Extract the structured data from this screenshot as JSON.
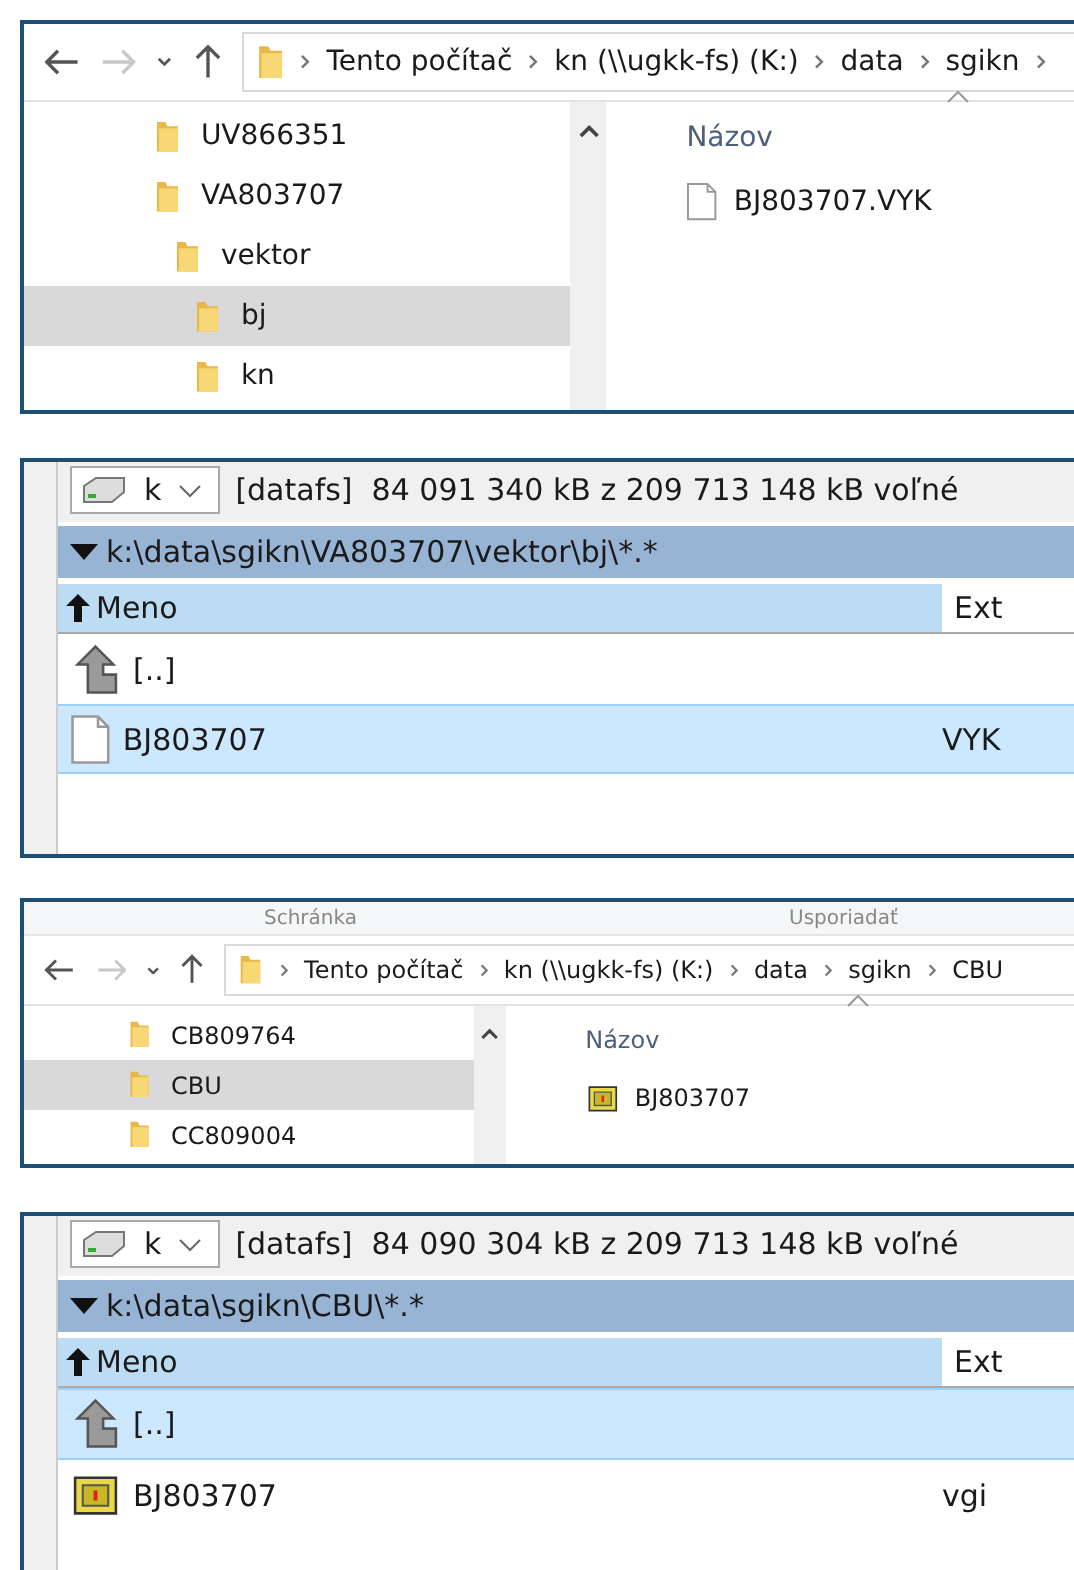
{
  "panels": [
    {
      "kind": "explorer",
      "breadcrumbs": [
        "Tento počítač",
        "kn (\\\\ugkk-fs) (K:)",
        "data",
        "sgikn"
      ],
      "more": true,
      "tree": [
        {
          "label": "UV866351",
          "selected": false
        },
        {
          "label": "VA803707",
          "selected": false,
          "children": [
            {
              "label": "vektor",
              "selected": false,
              "children": [
                {
                  "label": "bj",
                  "selected": true
                },
                {
                  "label": "kn",
                  "selected": false
                }
              ]
            }
          ]
        }
      ],
      "column": "Názov",
      "files": [
        {
          "name": "BJ803707.VYK",
          "kind": "document"
        }
      ]
    },
    {
      "kind": "commander",
      "drive": "k",
      "free": "[datafs]  84 091 340 kB z 209 713 148 kB voľné",
      "path": "k:\\data\\sgikn\\VA803707\\vektor\\bj\\*.*",
      "columns": [
        "Meno",
        "Ext"
      ],
      "rows": [
        {
          "kind": "parent",
          "name": "[..]",
          "ext": "",
          "selected": false
        },
        {
          "kind": "document",
          "name": "BJ803707",
          "ext": "VYK",
          "selected": true
        }
      ]
    },
    {
      "kind": "explorer",
      "ribbon": [
        "Schránka",
        "Usporiadať"
      ],
      "breadcrumbs": [
        "Tento počítač",
        "kn (\\\\ugkk-fs) (K:)",
        "data",
        "sgikn",
        "CBU"
      ],
      "more": false,
      "tree": [
        {
          "label": "CB809764",
          "selected": false
        },
        {
          "label": "CBU",
          "selected": true
        },
        {
          "label": "CC809004",
          "selected": false
        }
      ],
      "column": "Názov",
      "files": [
        {
          "name": "BJ803707",
          "kind": "map-file"
        }
      ]
    },
    {
      "kind": "commander",
      "drive": "k",
      "free": "[datafs]  84 090 304 kB z 209 713 148 kB voľné",
      "path": "k:\\data\\sgikn\\CBU\\*.*",
      "columns": [
        "Meno",
        "Ext"
      ],
      "rows": [
        {
          "kind": "parent",
          "name": "[..]",
          "ext": "",
          "selected": true
        },
        {
          "kind": "map-file",
          "name": "BJ803707",
          "ext": "vgi",
          "selected": false
        }
      ]
    }
  ]
}
